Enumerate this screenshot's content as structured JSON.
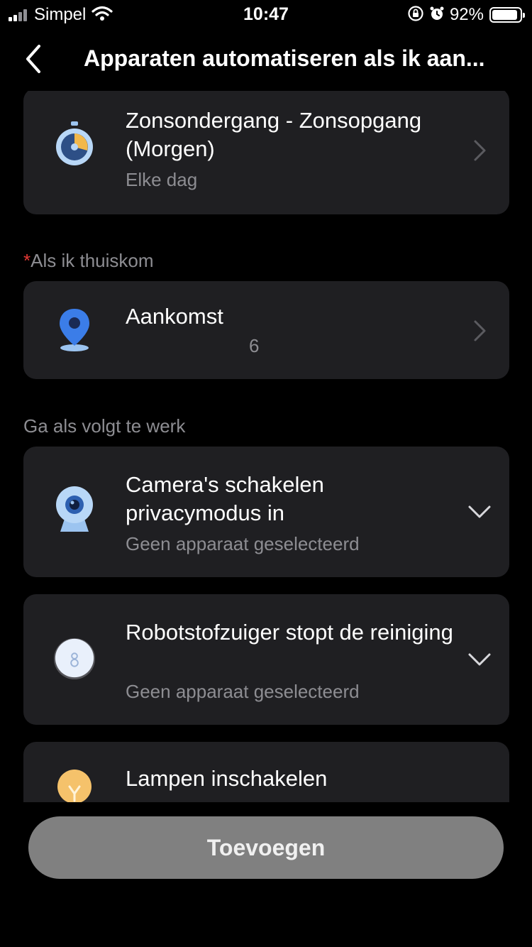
{
  "status_bar": {
    "carrier": "Simpel",
    "time": "10:47",
    "battery_percent": "92%",
    "battery_level": 0.92,
    "icons": [
      "signal-icon",
      "wifi-icon",
      "orientation-lock-icon",
      "alarm-icon",
      "battery-icon"
    ]
  },
  "header": {
    "title": "Apparaten automatiseren als ik aan...",
    "back_icon": "chevron-left-icon"
  },
  "schedule_card": {
    "title": "Zonsondergang - Zonsopgang (Morgen)",
    "subtitle": "Elke dag",
    "icon": "timer-icon"
  },
  "condition_section": {
    "required_mark": "*",
    "label": "Als ik thuiskom"
  },
  "arrival_card": {
    "title": "Aankomst",
    "value": "6",
    "icon": "location-pin-icon"
  },
  "actions_section": {
    "label": "Ga als volgt te werk"
  },
  "actions": [
    {
      "title": "Camera's schakelen privacymodus in",
      "subtitle": "Geen apparaat geselecteerd",
      "icon": "camera-icon"
    },
    {
      "title": "Robotstofzuiger stopt de reiniging",
      "subtitle": "Geen apparaat geselecteerd",
      "icon": "robot-vacuum-icon"
    },
    {
      "title": "Lampen inschakelen",
      "subtitle": "",
      "icon": "lightbulb-icon"
    }
  ],
  "footer": {
    "add_label": "Toevoegen"
  },
  "colors": {
    "background": "#000000",
    "card": "#1f1f22",
    "secondary_text": "#8d8d92",
    "required": "#e53935",
    "button": "#808080",
    "accent_blue": "#3b82f6",
    "bulb_yellow": "#f5c26b"
  }
}
